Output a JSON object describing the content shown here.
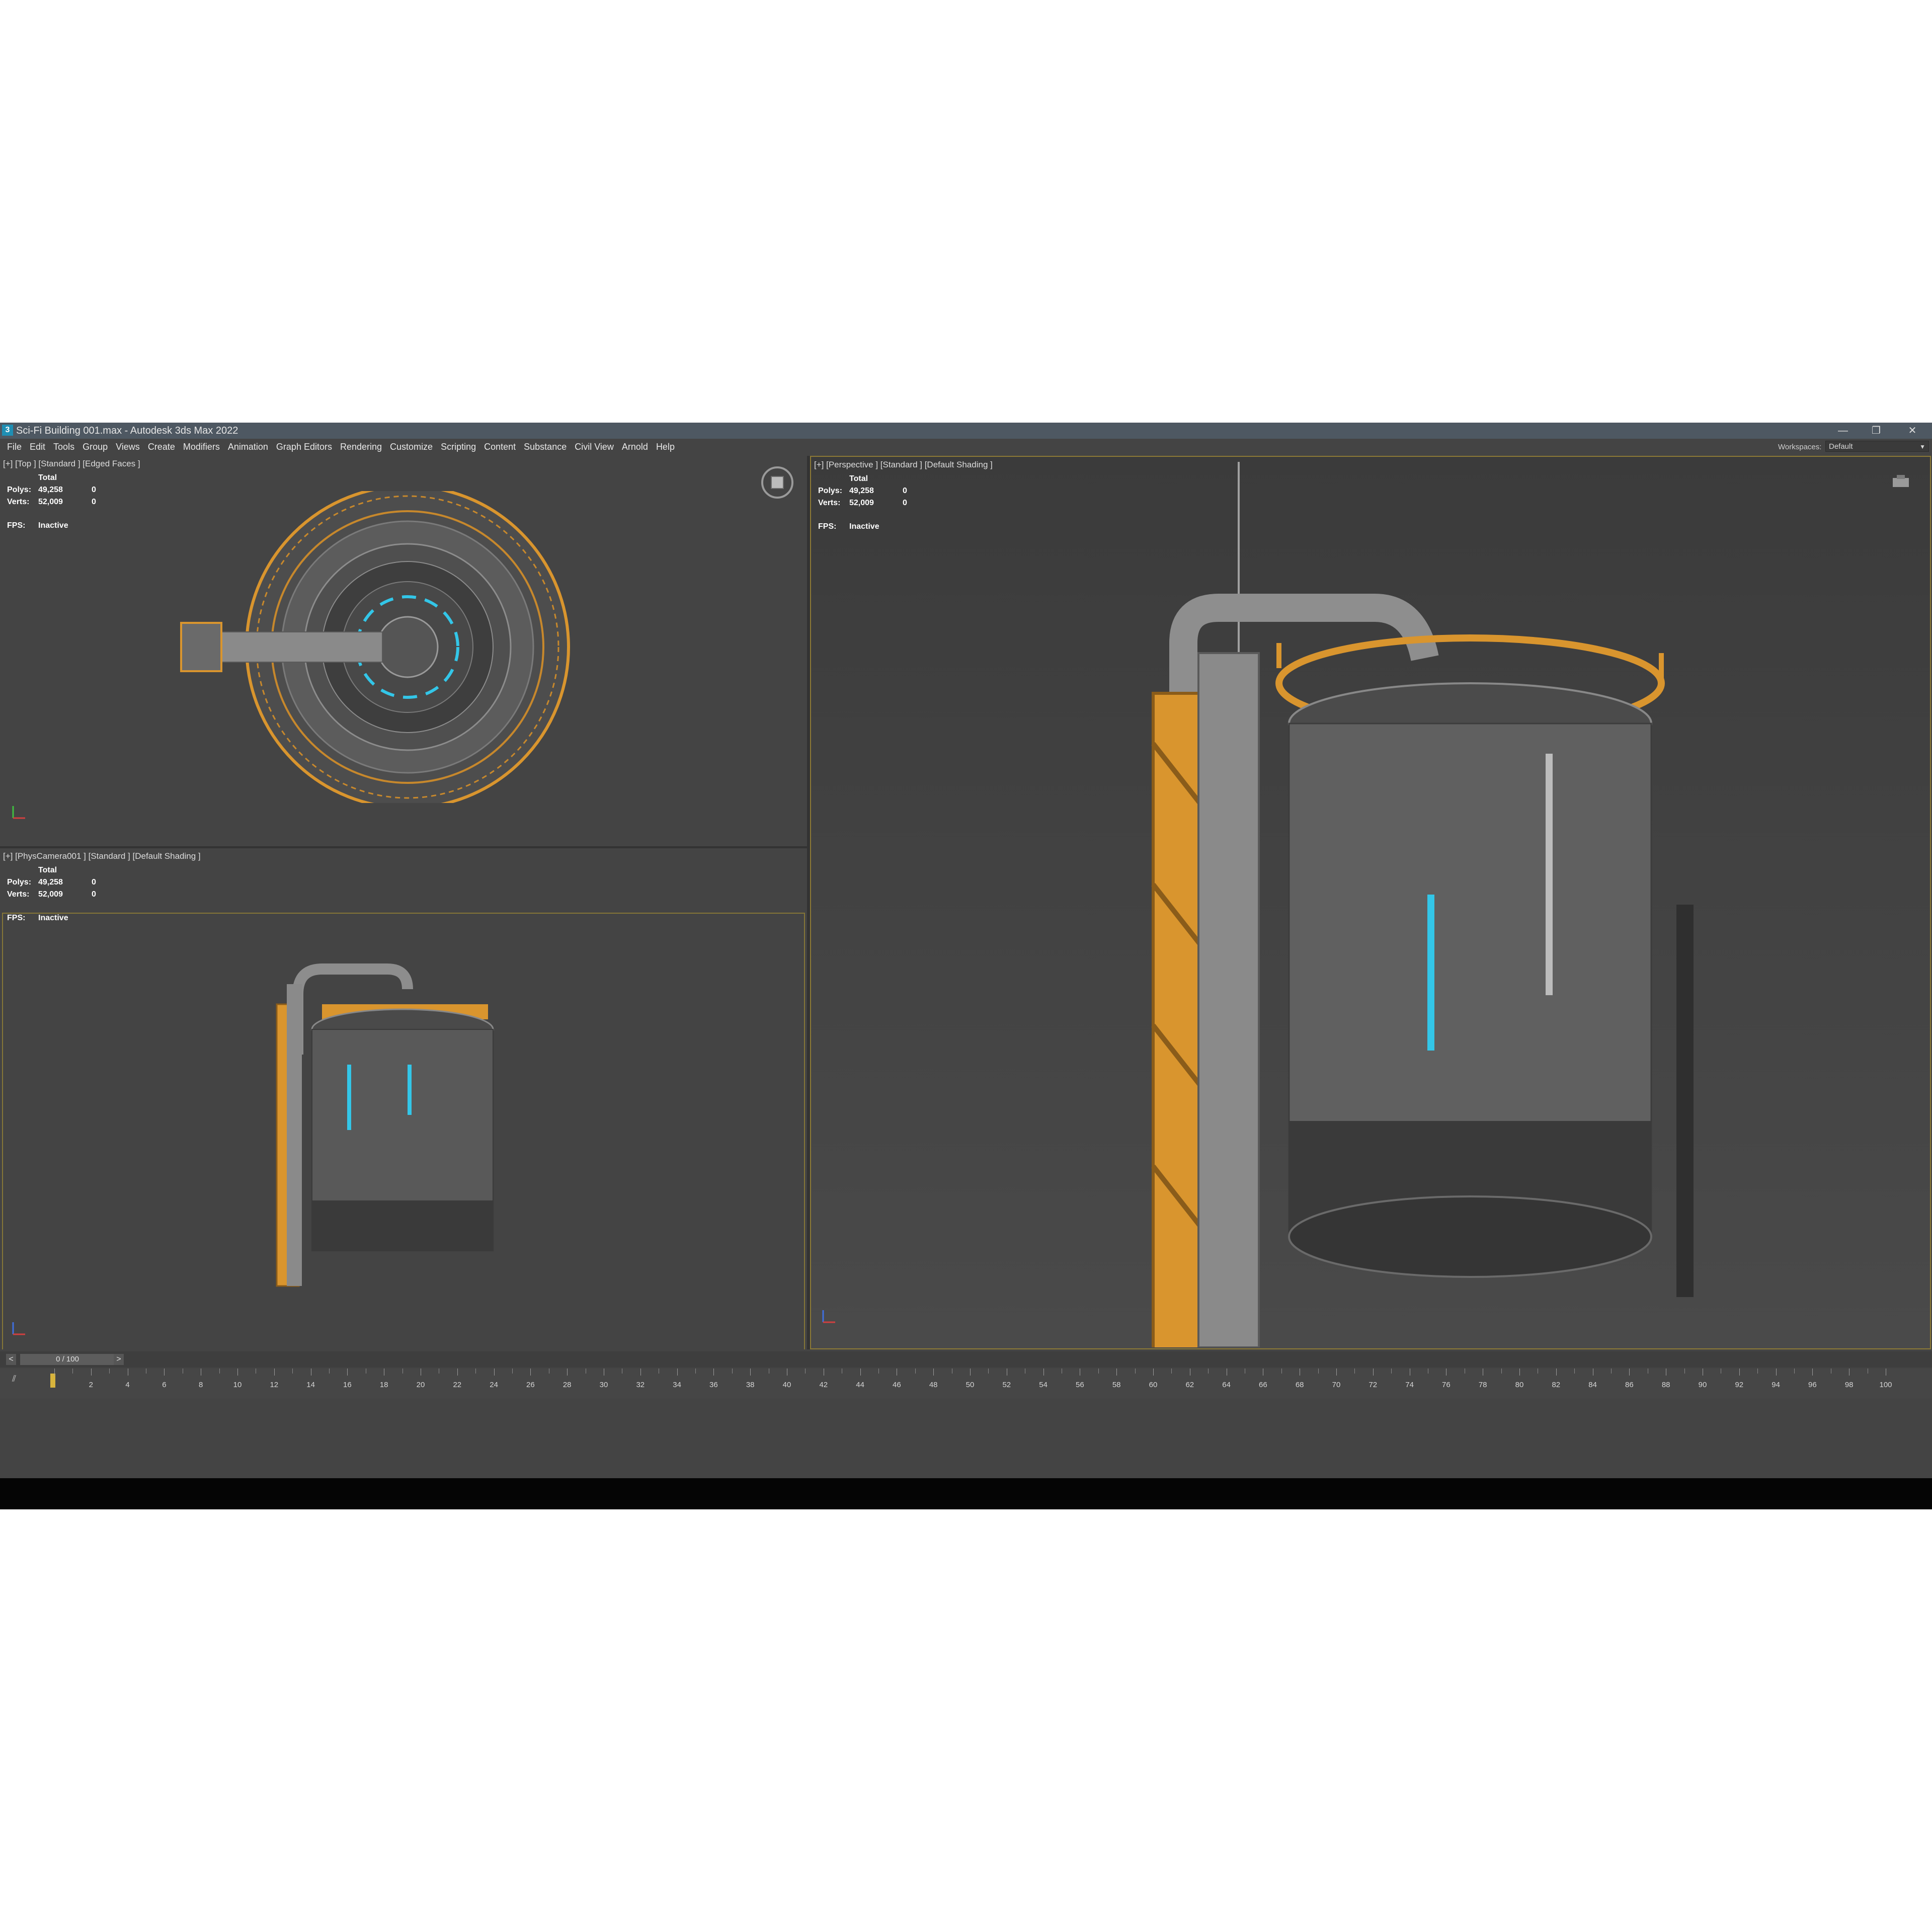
{
  "window": {
    "icon_label": "3",
    "title": "Sci-Fi Building 001.max - Autodesk 3ds Max 2022",
    "controls": {
      "minimize": "—",
      "restore": "❐",
      "close": "✕"
    }
  },
  "menubar": {
    "items": [
      "File",
      "Edit",
      "Tools",
      "Group",
      "Views",
      "Create",
      "Modifiers",
      "Animation",
      "Graph Editors",
      "Rendering",
      "Customize",
      "Scripting",
      "Content",
      "Substance",
      "Civil View",
      "Arnold",
      "Help"
    ],
    "workspaces_label": "Workspaces:",
    "workspace_value": "Default"
  },
  "viewports": {
    "top": {
      "label": "[+] [Top ] [Standard ] [Edged Faces ]",
      "stats": {
        "header": "Total",
        "polys_label": "Polys:",
        "polys_total": "49,258",
        "polys_sel": "0",
        "verts_label": "Verts:",
        "verts_total": "52,009",
        "verts_sel": "0"
      },
      "fps_label": "FPS:",
      "fps_value": "Inactive"
    },
    "camera": {
      "label": "[+] [PhysCamera001 ] [Standard ] [Default Shading ]",
      "stats": {
        "header": "Total",
        "polys_label": "Polys:",
        "polys_total": "49,258",
        "polys_sel": "0",
        "verts_label": "Verts:",
        "verts_total": "52,009",
        "verts_sel": "0"
      },
      "fps_label": "FPS:",
      "fps_value": "Inactive"
    },
    "perspective": {
      "label": "[+] [Perspective ] [Standard ] [Default Shading ]",
      "stats": {
        "header": "Total",
        "polys_label": "Polys:",
        "polys_total": "49,258",
        "polys_sel": "0",
        "verts_label": "Verts:",
        "verts_total": "52,009",
        "verts_sel": "0"
      },
      "fps_label": "FPS:",
      "fps_value": "Inactive"
    }
  },
  "timeline": {
    "prev": "<",
    "next": ">",
    "current": "0 / 100",
    "filter_icon": "filter-key-icon",
    "tick_labels": [
      "2",
      "4",
      "6",
      "8",
      "10",
      "12",
      "14",
      "16",
      "18",
      "20",
      "22",
      "24",
      "26",
      "28",
      "30",
      "32",
      "34",
      "36",
      "38",
      "40",
      "42",
      "44",
      "46",
      "48",
      "50",
      "52",
      "54",
      "56",
      "58",
      "60",
      "62",
      "64",
      "66",
      "68",
      "70",
      "72",
      "74",
      "76",
      "78",
      "80",
      "82",
      "84",
      "86",
      "88",
      "90",
      "92",
      "94",
      "96",
      "98",
      "100"
    ],
    "frame_start": 0,
    "frame_end": 100
  },
  "colors": {
    "accent_frame": "#8d7a36",
    "railing_orange": "#d9952e",
    "hull_grey": "#5b5b5b",
    "glow_cyan": "#33c6e8",
    "viewport_bg": "#444444",
    "titlebar": "#4e5862"
  }
}
